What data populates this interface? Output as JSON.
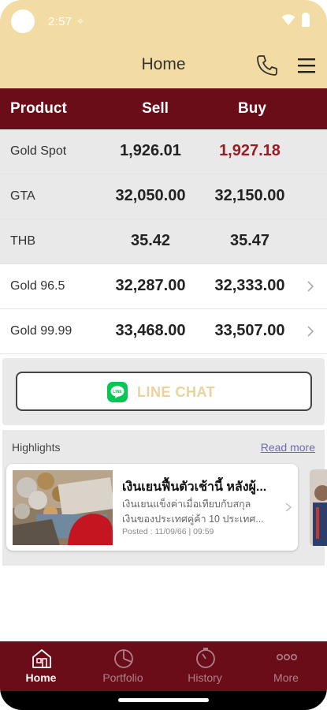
{
  "status": {
    "time": "2:57",
    "note_glyph": "⟡"
  },
  "header": {
    "title": "Home"
  },
  "table": {
    "columns": [
      "Product",
      "Sell",
      "Buy"
    ],
    "rows": [
      {
        "name": "Gold Spot",
        "sell": "1,926.01",
        "buy": "1,927.18"
      },
      {
        "name": "GTA",
        "sell": "32,050.00",
        "buy": "32,150.00"
      },
      {
        "name": "THB",
        "sell": "35.42",
        "buy": "35.47"
      },
      {
        "name": "Gold 96.5",
        "sell": "32,287.00",
        "buy": "32,333.00"
      },
      {
        "name": "Gold 99.99",
        "sell": "33,468.00",
        "buy": "33,507.00"
      }
    ]
  },
  "chat": {
    "label": "LINE CHAT",
    "icon_text": "LINE"
  },
  "highlights": {
    "title": "Highlights",
    "read_more": "Read more",
    "card": {
      "title": "เงินเยนฟื้นตัวเช้านี้ หลังผู้...",
      "desc1": "เงินเยนแข็งค่าเมื่อเทียบกับสกุล",
      "desc2": "เงินของประเทศคู่ค้า 10 ประเทศ...",
      "date": "Posted : 11/09/66 | 09:59"
    }
  },
  "nav": {
    "items": [
      {
        "label": "Home"
      },
      {
        "label": "Portfolio"
      },
      {
        "label": "History"
      },
      {
        "label": "More"
      }
    ]
  },
  "colors": {
    "appbar": "#f3dca3",
    "primary": "#6a0d18",
    "buy_highlight": "#9b1b22",
    "chat_text": "#e9d39d",
    "line_green": "#06c755"
  }
}
